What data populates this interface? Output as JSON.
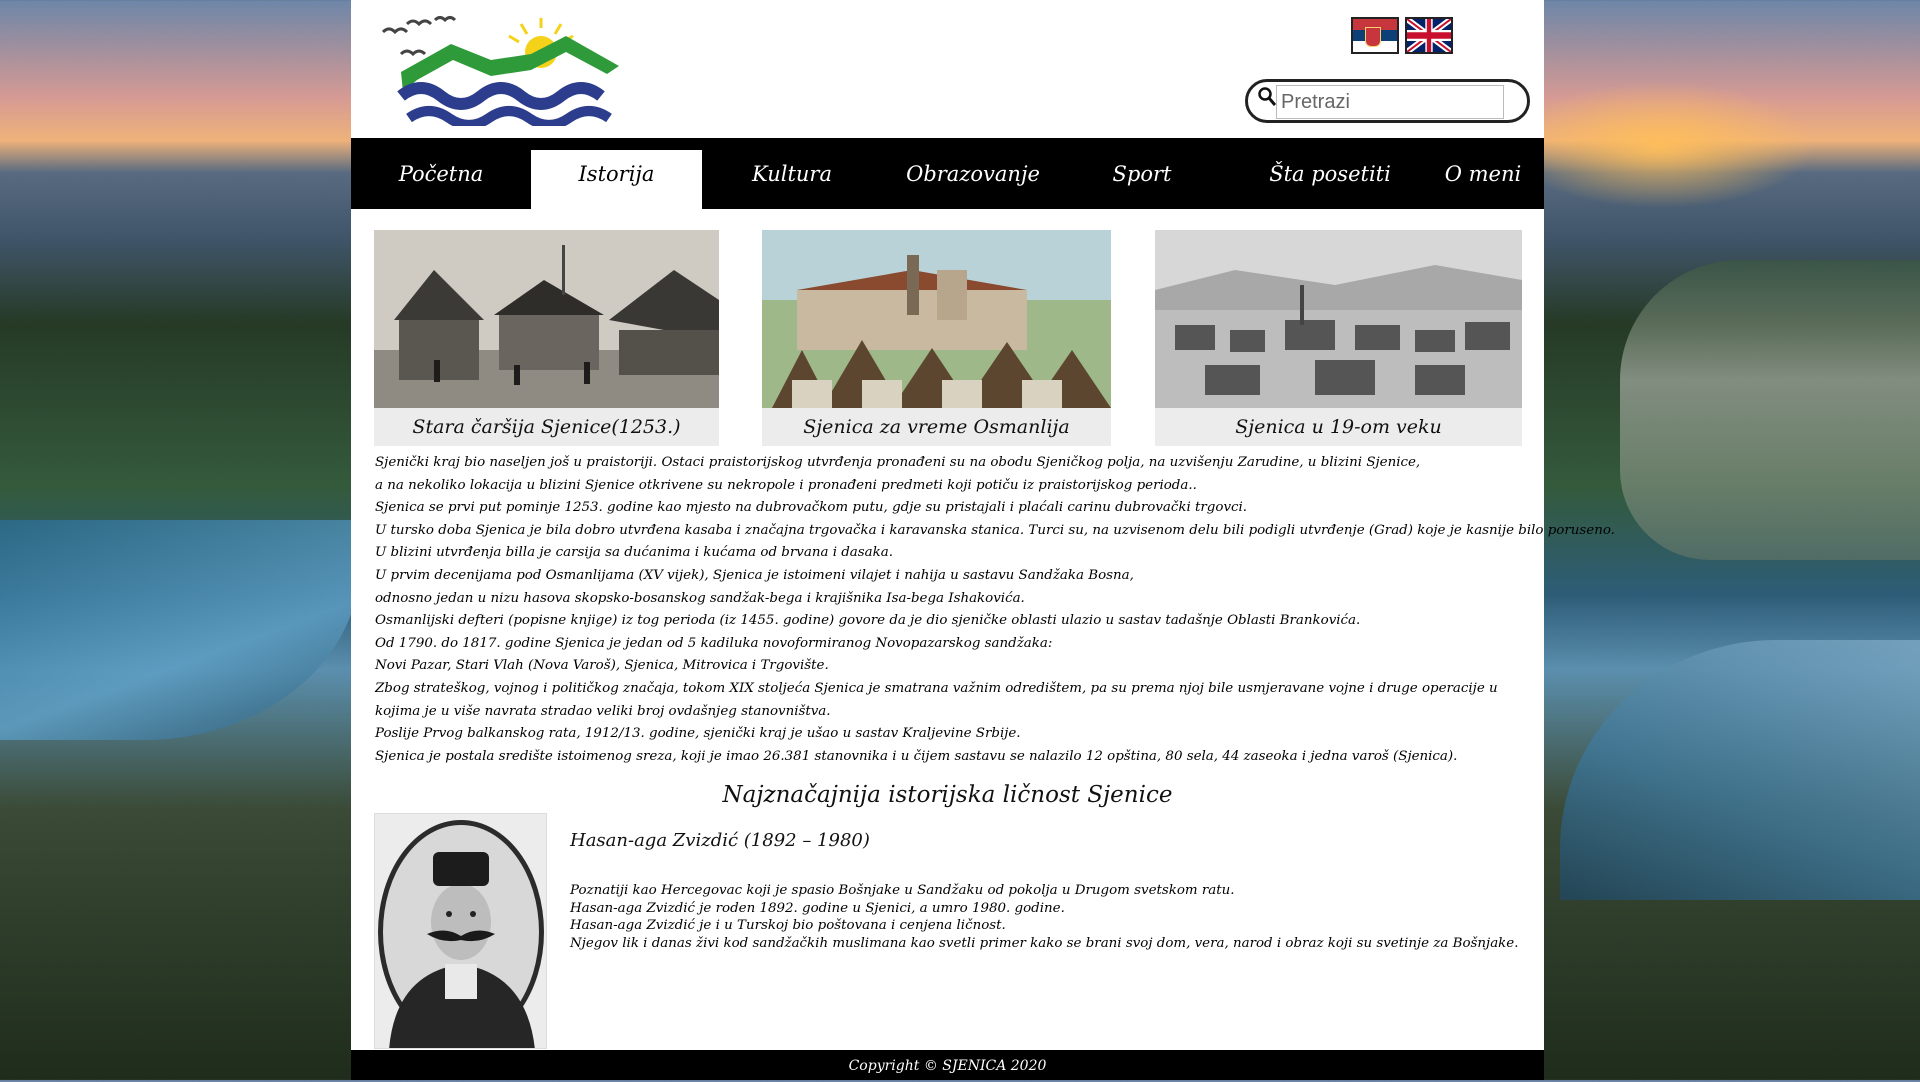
{
  "header": {
    "search_placeholder": "Pretrazi",
    "flags": [
      {
        "icon": "serbia-flag-icon",
        "colors": [
          "#c6363c",
          "#0c4076",
          "#ffffff"
        ]
      },
      {
        "icon": "uk-flag-icon",
        "colors": [
          "#012169",
          "#ffffff",
          "#c8102e"
        ]
      }
    ]
  },
  "nav": {
    "items": [
      {
        "label": "Početna"
      },
      {
        "label": "Istorija",
        "active": true
      },
      {
        "label": "Kultura"
      },
      {
        "label": "Obrazovanje"
      },
      {
        "label": "Sport"
      },
      {
        "label": "Šta posetiti"
      },
      {
        "label": "O meni"
      }
    ]
  },
  "gallery": [
    {
      "caption": "Stara čaršija Sjenice(1253.)"
    },
    {
      "caption": "Sjenica za vreme Osmanlija"
    },
    {
      "caption": "Sjenica u 19-om veku"
    }
  ],
  "history": [
    "Sjenički kraj bio naseljen još u praistoriji. Ostaci praistorijskog utvrđenja pronađeni su na obodu Sjeničkog polja, na uzvišenju Zarudine, u blizini Sjenice,",
    " a na nekoliko lokacija u blizini Sjenice otkrivene su nekropole i pronađeni predmeti koji potiču iz praistorijskog perioda..",
    "Sjenica se prvi put pominje 1253. godine kao mjesto na dubrovačkom putu, gdje su pristajali i plaćali carinu dubrovački trgovci.",
    "U tursko doba Sjenica je bila dobro utvrđena kasaba i značajna trgovačka i karavanska stanica. Turci su, na uzvisenom delu bili podigli utvrđenje (Grad) koje je kasnije bilo poruseno.",
    "U blizini utvrđenja billa je carsija sa dućanima i kućama od brvana i dasaka.",
    "U prvim decenijama pod Osmanlijama (XV vijek), Sjenica je istoimeni vilajet i nahija u sastavu Sandžaka Bosna,",
    "odnosno jedan u nizu hasova skopsko-bosanskog sandžak-bega i krajišnika Isa-bega Ishakovića.",
    "Osmanlijski defteri (popisne knjige) iz tog perioda (iz 1455. godine) govore da je dio sjeničke oblasti ulazio u sastav tadašnje Oblasti Brankovića.",
    "Od 1790. do 1817. godine Sjenica je jedan od 5 kadiluka novoformiranog Novopazarskog sandžaka:",
    "Novi Pazar, Stari Vlah (Nova Varoš), Sjenica, Mitrovica i Trgovište.",
    "Zbog strateškog, vojnog i političkog značaja, tokom XIX stoljeća Sjenica je smatrana važnim odredištem, pa su prema njoj bile usmjeravane vojne i druge operacije u",
    " kojima je u više navrata stradao veliki broj ovdašnjeg stanovništva.",
    "Poslije Prvog balkanskog rata, 1912/13. godine, sjenički kraj je ušao u sastav Kraljevine Srbije.",
    "Sjenica je postala središte istoimenog sreza, koji je imao 26.381 stanovnika i u čijem sastavu se nalazilo 12 opština, 80 sela, 44 zaseoka i jedna varoš (Sjenica)."
  ],
  "person": {
    "heading": "Najznačajnija istorijska ličnost Sjenice",
    "name": "Hasan-aga Zvizdić (1892 – 1980)",
    "lines": [
      "Poznatiji kao Hercegovac koji je spasio Bošnjake u Sandžaku od pokolja u Drugom svetskom ratu.",
      "Hasan-aga Zvizdić je roden 1892. godine u Sjenici, a umro 1980. godine.",
      "Hasan-aga Zvizdić je i u Turskoj bio poštovana i cenjena ličnost.",
      "Njegov lik i danas živi kod sandžačkih muslimana kao svetli primer kako se brani svoj dom, vera, narod i obraz koji su svetinje za Bošnjake."
    ]
  },
  "footer": {
    "text": "Copyright © SJENICA 2020"
  }
}
